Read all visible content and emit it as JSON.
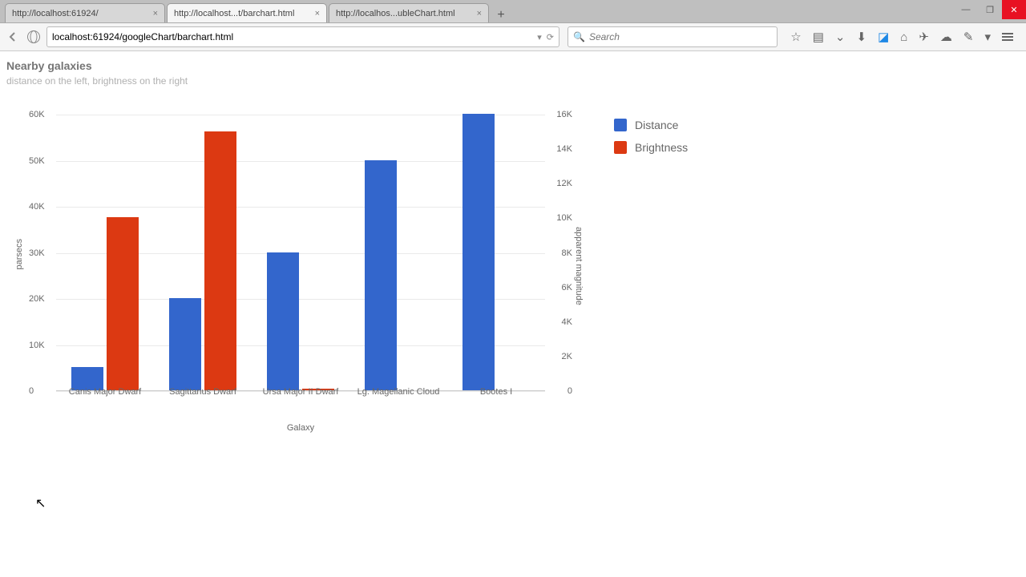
{
  "window": {
    "minimize_tooltip": "Minimize",
    "maximize_tooltip": "Restore",
    "close_tooltip": "Close"
  },
  "tabs": [
    {
      "label": "http://localhost:61924/",
      "active": false
    },
    {
      "label": "http://localhost...t/barchart.html",
      "active": true
    },
    {
      "label": "http://localhos...ubleChart.html",
      "active": false
    }
  ],
  "newtab_label": "+",
  "url": "localhost:61924/googleChart/barchart.html",
  "search_placeholder": "Search",
  "toolbar_icons": [
    "star-icon",
    "calendar-icon",
    "pocket-icon",
    "download-icon",
    "apps-icon",
    "home-icon",
    "send-icon",
    "chat-icon",
    "paint-icon",
    "dropdown-icon",
    "menu-icon"
  ],
  "chart_data": {
    "type": "bar",
    "title": "Nearby galaxies",
    "subtitle": "distance on the left, brightness on the right",
    "xlabel": "Galaxy",
    "y_left_label": "parsecs",
    "y_right_label": "apparent magnitude",
    "y_left_range": [
      0,
      60000
    ],
    "y_right_range": [
      0,
      16000
    ],
    "y_left_ticks": [
      "0",
      "10K",
      "20K",
      "30K",
      "40K",
      "50K",
      "60K"
    ],
    "y_right_ticks": [
      "0",
      "2K",
      "4K",
      "6K",
      "8K",
      "10K",
      "12K",
      "14K",
      "16K"
    ],
    "categories": [
      "Canis Major Dwarf",
      "Sagittarius Dwarf",
      "Ursa Major II Dwarf",
      "Lg. Magellanic Cloud",
      "Bootes I"
    ],
    "series": [
      {
        "name": "Distance",
        "axis": "left",
        "color": "#3366cc",
        "values": [
          5000,
          20000,
          30000,
          50000,
          60000
        ]
      },
      {
        "name": "Brightness",
        "axis": "right",
        "color": "#dc3912",
        "values": [
          10000,
          15000,
          100,
          0,
          0
        ]
      }
    ]
  }
}
